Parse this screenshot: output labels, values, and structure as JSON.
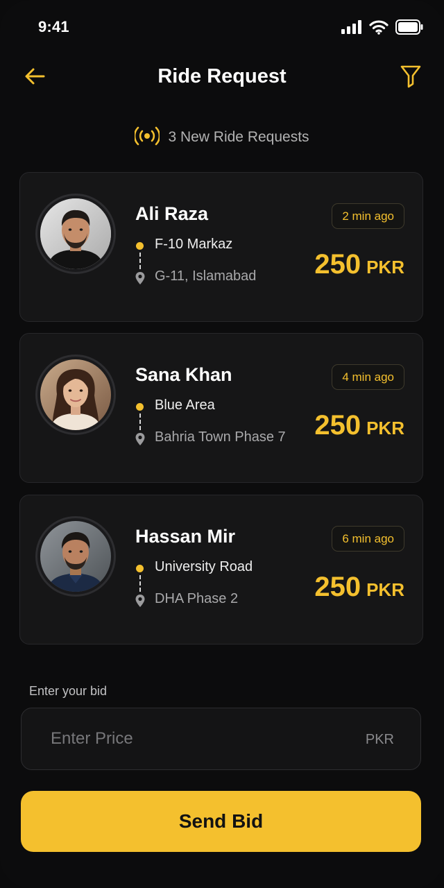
{
  "status_bar": {
    "time": "9:41"
  },
  "header": {
    "title": "Ride Request"
  },
  "banner": {
    "text": "3 New Ride Requests"
  },
  "colors": {
    "accent": "#f4c02e",
    "background": "#0c0c0d",
    "card": "#161617"
  },
  "requests": [
    {
      "name": "Ali Raza",
      "pickup": "F-10 Markaz",
      "dropoff": "G-11, Islamabad",
      "time_ago": "2 min ago",
      "fare": "250",
      "currency": "PKR"
    },
    {
      "name": "Sana Khan",
      "pickup": "Blue Area",
      "dropoff": "Bahria Town Phase 7",
      "time_ago": "4 min ago",
      "fare": "250",
      "currency": "PKR"
    },
    {
      "name": "Hassan Mir",
      "pickup": "University Road",
      "dropoff": "DHA Phase 2",
      "time_ago": "6 min ago",
      "fare": "250",
      "currency": "PKR"
    }
  ],
  "bid": {
    "label": "Enter your bid",
    "placeholder": "Enter Price",
    "unit": "PKR",
    "button_label": "Send Bid"
  }
}
